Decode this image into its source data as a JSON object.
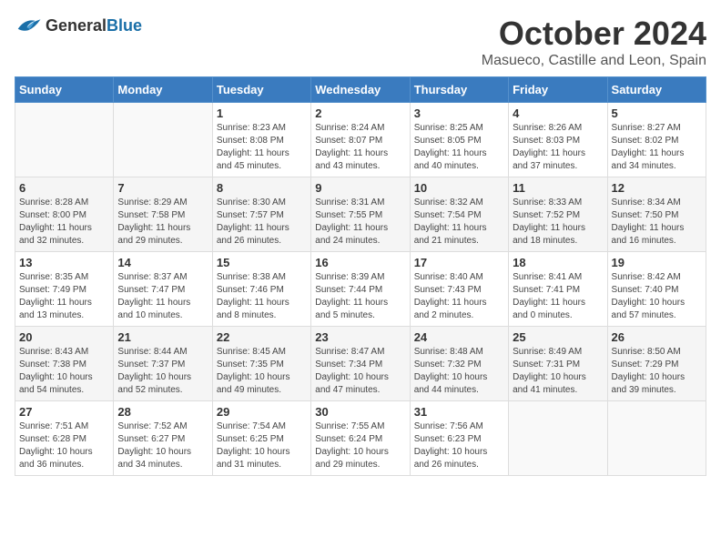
{
  "header": {
    "logo_general": "General",
    "logo_blue": "Blue",
    "month": "October 2024",
    "location": "Masueco, Castille and Leon, Spain"
  },
  "weekdays": [
    "Sunday",
    "Monday",
    "Tuesday",
    "Wednesday",
    "Thursday",
    "Friday",
    "Saturday"
  ],
  "weeks": [
    [
      {
        "day": "",
        "info": ""
      },
      {
        "day": "",
        "info": ""
      },
      {
        "day": "1",
        "info": "Sunrise: 8:23 AM\nSunset: 8:08 PM\nDaylight: 11 hours\nand 45 minutes."
      },
      {
        "day": "2",
        "info": "Sunrise: 8:24 AM\nSunset: 8:07 PM\nDaylight: 11 hours\nand 43 minutes."
      },
      {
        "day": "3",
        "info": "Sunrise: 8:25 AM\nSunset: 8:05 PM\nDaylight: 11 hours\nand 40 minutes."
      },
      {
        "day": "4",
        "info": "Sunrise: 8:26 AM\nSunset: 8:03 PM\nDaylight: 11 hours\nand 37 minutes."
      },
      {
        "day": "5",
        "info": "Sunrise: 8:27 AM\nSunset: 8:02 PM\nDaylight: 11 hours\nand 34 minutes."
      }
    ],
    [
      {
        "day": "6",
        "info": "Sunrise: 8:28 AM\nSunset: 8:00 PM\nDaylight: 11 hours\nand 32 minutes."
      },
      {
        "day": "7",
        "info": "Sunrise: 8:29 AM\nSunset: 7:58 PM\nDaylight: 11 hours\nand 29 minutes."
      },
      {
        "day": "8",
        "info": "Sunrise: 8:30 AM\nSunset: 7:57 PM\nDaylight: 11 hours\nand 26 minutes."
      },
      {
        "day": "9",
        "info": "Sunrise: 8:31 AM\nSunset: 7:55 PM\nDaylight: 11 hours\nand 24 minutes."
      },
      {
        "day": "10",
        "info": "Sunrise: 8:32 AM\nSunset: 7:54 PM\nDaylight: 11 hours\nand 21 minutes."
      },
      {
        "day": "11",
        "info": "Sunrise: 8:33 AM\nSunset: 7:52 PM\nDaylight: 11 hours\nand 18 minutes."
      },
      {
        "day": "12",
        "info": "Sunrise: 8:34 AM\nSunset: 7:50 PM\nDaylight: 11 hours\nand 16 minutes."
      }
    ],
    [
      {
        "day": "13",
        "info": "Sunrise: 8:35 AM\nSunset: 7:49 PM\nDaylight: 11 hours\nand 13 minutes."
      },
      {
        "day": "14",
        "info": "Sunrise: 8:37 AM\nSunset: 7:47 PM\nDaylight: 11 hours\nand 10 minutes."
      },
      {
        "day": "15",
        "info": "Sunrise: 8:38 AM\nSunset: 7:46 PM\nDaylight: 11 hours\nand 8 minutes."
      },
      {
        "day": "16",
        "info": "Sunrise: 8:39 AM\nSunset: 7:44 PM\nDaylight: 11 hours\nand 5 minutes."
      },
      {
        "day": "17",
        "info": "Sunrise: 8:40 AM\nSunset: 7:43 PM\nDaylight: 11 hours\nand 2 minutes."
      },
      {
        "day": "18",
        "info": "Sunrise: 8:41 AM\nSunset: 7:41 PM\nDaylight: 11 hours\nand 0 minutes."
      },
      {
        "day": "19",
        "info": "Sunrise: 8:42 AM\nSunset: 7:40 PM\nDaylight: 10 hours\nand 57 minutes."
      }
    ],
    [
      {
        "day": "20",
        "info": "Sunrise: 8:43 AM\nSunset: 7:38 PM\nDaylight: 10 hours\nand 54 minutes."
      },
      {
        "day": "21",
        "info": "Sunrise: 8:44 AM\nSunset: 7:37 PM\nDaylight: 10 hours\nand 52 minutes."
      },
      {
        "day": "22",
        "info": "Sunrise: 8:45 AM\nSunset: 7:35 PM\nDaylight: 10 hours\nand 49 minutes."
      },
      {
        "day": "23",
        "info": "Sunrise: 8:47 AM\nSunset: 7:34 PM\nDaylight: 10 hours\nand 47 minutes."
      },
      {
        "day": "24",
        "info": "Sunrise: 8:48 AM\nSunset: 7:32 PM\nDaylight: 10 hours\nand 44 minutes."
      },
      {
        "day": "25",
        "info": "Sunrise: 8:49 AM\nSunset: 7:31 PM\nDaylight: 10 hours\nand 41 minutes."
      },
      {
        "day": "26",
        "info": "Sunrise: 8:50 AM\nSunset: 7:29 PM\nDaylight: 10 hours\nand 39 minutes."
      }
    ],
    [
      {
        "day": "27",
        "info": "Sunrise: 7:51 AM\nSunset: 6:28 PM\nDaylight: 10 hours\nand 36 minutes."
      },
      {
        "day": "28",
        "info": "Sunrise: 7:52 AM\nSunset: 6:27 PM\nDaylight: 10 hours\nand 34 minutes."
      },
      {
        "day": "29",
        "info": "Sunrise: 7:54 AM\nSunset: 6:25 PM\nDaylight: 10 hours\nand 31 minutes."
      },
      {
        "day": "30",
        "info": "Sunrise: 7:55 AM\nSunset: 6:24 PM\nDaylight: 10 hours\nand 29 minutes."
      },
      {
        "day": "31",
        "info": "Sunrise: 7:56 AM\nSunset: 6:23 PM\nDaylight: 10 hours\nand 26 minutes."
      },
      {
        "day": "",
        "info": ""
      },
      {
        "day": "",
        "info": ""
      }
    ]
  ]
}
